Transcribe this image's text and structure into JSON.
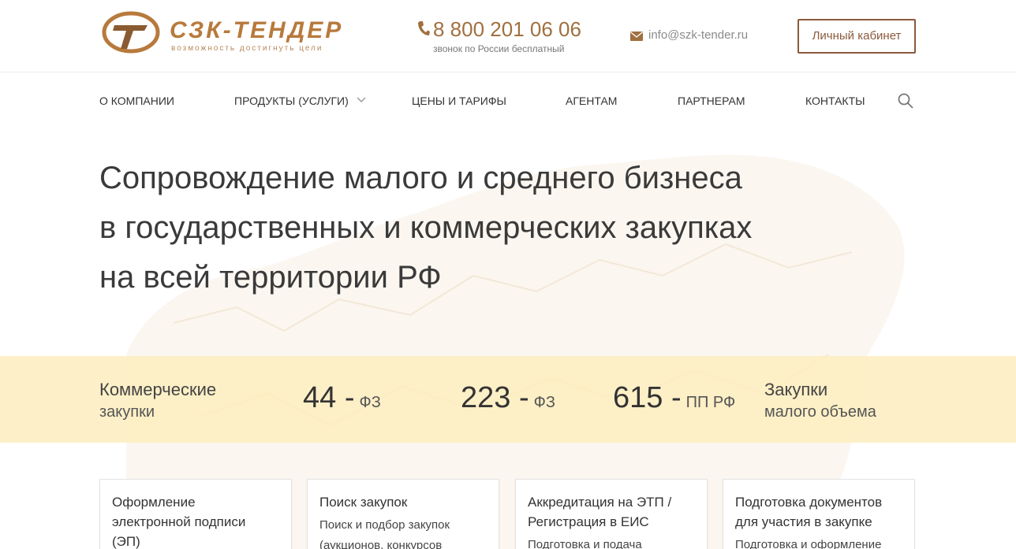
{
  "header": {
    "logo_name": "СЗК-ТЕНДЕР",
    "logo_tagline": "возможность достигнуть цели",
    "phone": "8 800 201 06 06",
    "phone_note": "звонок по России бесплатный",
    "email": "info@szk-tender.ru",
    "cabinet_label": "Личный кабинет"
  },
  "nav": {
    "items": [
      {
        "label": "О компании"
      },
      {
        "label": "Продукты (услуги)"
      },
      {
        "label": "Цены и тарифы"
      },
      {
        "label": "Агентам"
      },
      {
        "label": "Партнерам"
      },
      {
        "label": "Контакты"
      }
    ]
  },
  "hero": {
    "line1": "Сопровождение малого и среднего бизнеса",
    "line2": "в государственных и коммерческих закупках",
    "line3": "на всей территории РФ"
  },
  "stats": {
    "commercial_1": "Коммерческие",
    "commercial_2": "закупки",
    "s44_num": "44 -",
    "s44_law": "ФЗ",
    "s223_num": "223 -",
    "s223_law": "ФЗ",
    "s615_num": "615 -",
    "s615_law": "ПП РФ",
    "small_1": "Закупки",
    "small_2": "малого объема"
  },
  "cards": [
    {
      "title_1": "Оформление",
      "title_2": "электронной подписи",
      "title_3": "(ЭП)"
    },
    {
      "title_1": "Поиск закупок",
      "desc_1": "Поиск и подбор закупок",
      "desc_2": "(аукционов, конкурсов"
    },
    {
      "title_1": "Аккредитация на ЭТП /",
      "title_2": "Регистрация в ЕИС",
      "desc_1": "Подготовка и подача"
    },
    {
      "title_1": "Подготовка документов",
      "title_2": "для участия в закупке",
      "desc_1": "Подготовка и оформление"
    }
  ],
  "colors": {
    "brand": "#b77a3c",
    "button_border": "#8b5a3c",
    "band": "#fdedbe"
  }
}
